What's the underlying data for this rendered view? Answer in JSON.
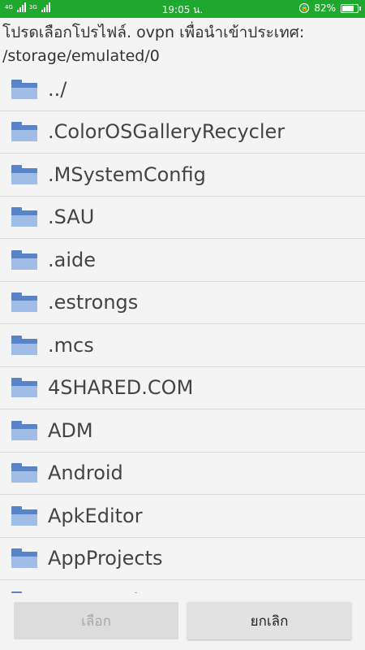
{
  "status_bar": {
    "network_left": "4G",
    "network_right": "3G",
    "time": "19:05 น.",
    "battery": "82%",
    "battery_level": 0.82
  },
  "dialog": {
    "title": "โปรดเลือกโปรไฟล์. ovpn เพื่อนำเข้าประเทศ: /storage/emulated/0"
  },
  "files": [
    {
      "name": "../"
    },
    {
      "name": ".ColorOSGalleryRecycler"
    },
    {
      "name": ".MSystemConfig"
    },
    {
      "name": ".SAU"
    },
    {
      "name": ".aide"
    },
    {
      "name": ".estrongs"
    },
    {
      "name": ".mcs"
    },
    {
      "name": "4SHARED.COM"
    },
    {
      "name": "ADM"
    },
    {
      "name": "Android"
    },
    {
      "name": "ApkEditor"
    },
    {
      "name": "AppProjects"
    },
    {
      "name": "AzRecorderFree"
    }
  ],
  "buttons": {
    "select_label": "เลือก",
    "cancel_label": "ยกเลิก"
  }
}
